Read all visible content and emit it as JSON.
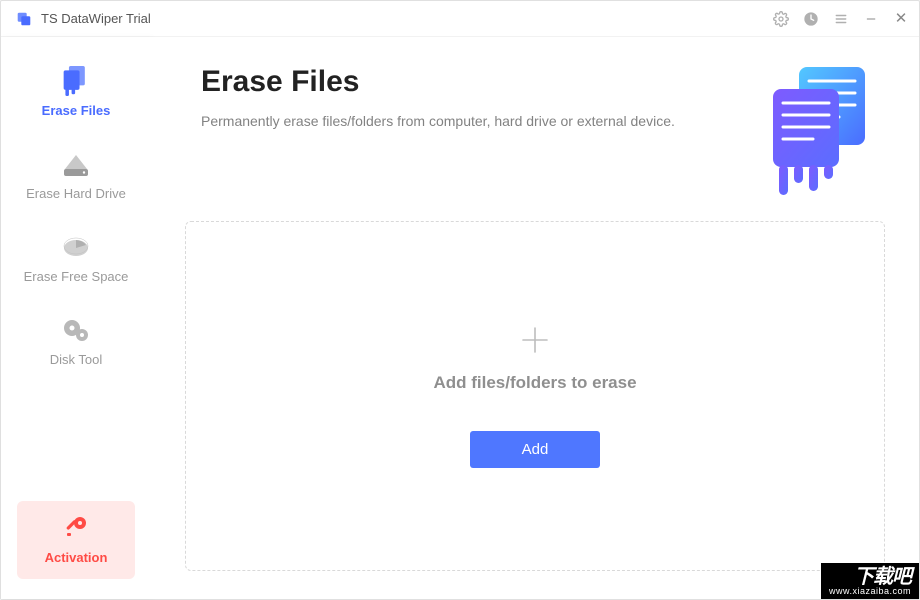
{
  "app": {
    "title": "TS DataWiper Trial"
  },
  "titlebar": {
    "settings_icon": "gear-icon",
    "clock_icon": "clock-icon",
    "menu_icon": "menu-icon",
    "minimize": "–",
    "close": "✕"
  },
  "sidebar": {
    "items": [
      {
        "label": "Erase Files",
        "icon": "files-icon",
        "active": true
      },
      {
        "label": "Erase Hard Drive",
        "icon": "harddrive-icon",
        "active": false
      },
      {
        "label": "Erase Free Space",
        "icon": "pie-icon",
        "active": false
      },
      {
        "label": "Disk Tool",
        "icon": "gears-icon",
        "active": false
      }
    ],
    "activation": {
      "label": "Activation"
    }
  },
  "main": {
    "title": "Erase Files",
    "subtitle": "Permanently erase files/folders from computer, hard drive or external device.",
    "dropzone": {
      "label": "Add files/folders to erase",
      "button": "Add"
    }
  },
  "watermark": {
    "big": "下载吧",
    "small": "www.xiazaiba.com"
  }
}
